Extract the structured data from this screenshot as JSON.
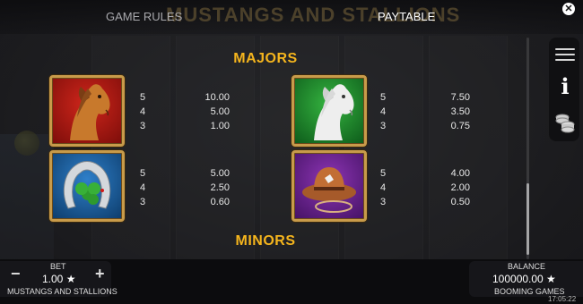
{
  "header": {
    "background_title": "MUSTANGS AND STALLIONS",
    "tabs": [
      {
        "label": "GAME RULES",
        "active": false
      },
      {
        "label": "PAYTABLE",
        "active": true
      }
    ],
    "close_icon": "close-icon"
  },
  "paytable": {
    "majors_title": "MAJORS",
    "minors_title": "MINORS",
    "symbols": [
      {
        "name": "brown-horse",
        "icon": "brown-horse-icon",
        "tile_color": "#c0231a",
        "payouts": [
          {
            "count": "5",
            "value": "10.00"
          },
          {
            "count": "4",
            "value": "5.00"
          },
          {
            "count": "3",
            "value": "1.00"
          }
        ]
      },
      {
        "name": "white-horse",
        "icon": "white-horse-icon",
        "tile_color": "#2aa337",
        "payouts": [
          {
            "count": "5",
            "value": "7.50"
          },
          {
            "count": "4",
            "value": "3.50"
          },
          {
            "count": "3",
            "value": "0.75"
          }
        ]
      },
      {
        "name": "horseshoe-clover",
        "icon": "horseshoe-icon",
        "tile_color": "#2e7fc9",
        "payouts": [
          {
            "count": "5",
            "value": "5.00"
          },
          {
            "count": "4",
            "value": "2.50"
          },
          {
            "count": "3",
            "value": "0.60"
          }
        ]
      },
      {
        "name": "cowboy-hat",
        "icon": "cowboy-hat-icon",
        "tile_color": "#8d35b4",
        "payouts": [
          {
            "count": "5",
            "value": "4.00"
          },
          {
            "count": "4",
            "value": "2.00"
          },
          {
            "count": "3",
            "value": "0.50"
          }
        ]
      }
    ]
  },
  "sidebar": {
    "menu_icon": "menu-icon",
    "info_icon": "info-icon",
    "info_glyph": "i",
    "coins_icon": "coins-stack-icon"
  },
  "footer": {
    "bet_label": "BET",
    "bet_value": "1.00 ★",
    "bet_minus": "−",
    "bet_plus": "+",
    "game_name": "MUSTANGS AND STALLIONS",
    "balance_label": "BALANCE",
    "balance_value": "100000.00 ★",
    "brand": "BOOMING GAMES",
    "clock": "17:05:22"
  },
  "colors": {
    "accent_gold": "#f5b51d",
    "tile_border": "#c89b4a"
  }
}
